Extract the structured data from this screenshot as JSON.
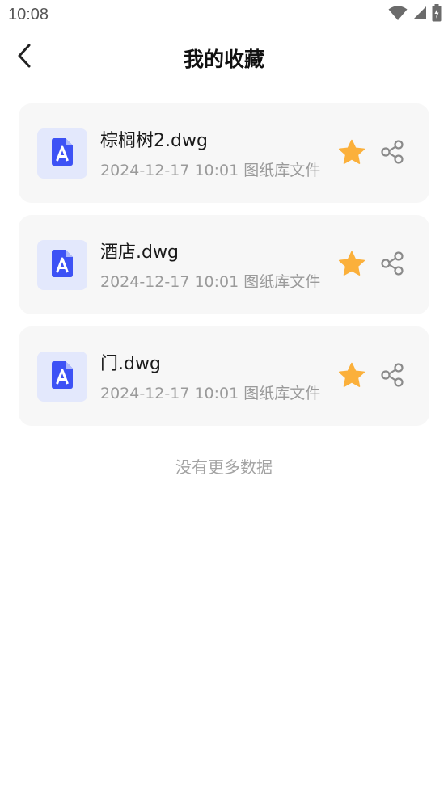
{
  "status_bar": {
    "time": "10:08",
    "icons": [
      "wifi-icon",
      "signal-icon",
      "battery-charging-icon"
    ]
  },
  "header": {
    "title": "我的收藏",
    "back_icon": "chevron-left-icon"
  },
  "files": [
    {
      "name": "棕榈树2.dwg",
      "meta": "2024-12-17 10:01 图纸库文件",
      "icon": "cad-file-icon",
      "favorited": true
    },
    {
      "name": "酒店.dwg",
      "meta": "2024-12-17 10:01 图纸库文件",
      "icon": "cad-file-icon",
      "favorited": true
    },
    {
      "name": "门.dwg",
      "meta": "2024-12-17 10:01 图纸库文件",
      "icon": "cad-file-icon",
      "favorited": true
    }
  ],
  "footer": {
    "no_more_text": "没有更多数据"
  },
  "colors": {
    "accent": "#3d52f5",
    "icon_tile_bg": "#e3e8fc",
    "star": "#fbb03b",
    "card_bg": "#f7f7f7",
    "secondary_text": "#9a9a9a"
  }
}
